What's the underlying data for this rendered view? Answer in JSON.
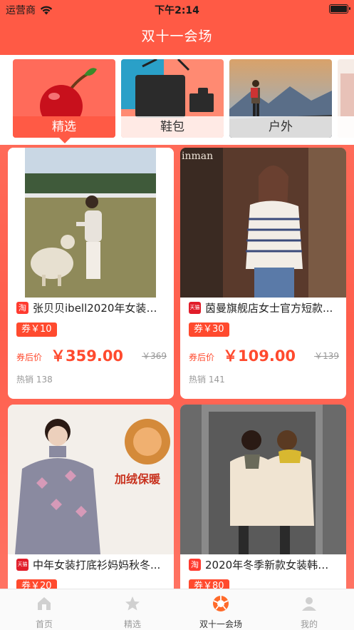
{
  "status": {
    "carrier": "运营商",
    "time": "下午2:14"
  },
  "nav": {
    "title": "双十一会场"
  },
  "categories": [
    {
      "label": "精选",
      "active": true
    },
    {
      "label": "鞋包",
      "active": false
    },
    {
      "label": "户外",
      "active": false
    }
  ],
  "products": [
    {
      "shop": "淘",
      "title": "张贝贝ibell2020年女装新...",
      "coupon": "券￥10",
      "price_label": "券后价",
      "price": "￥359.00",
      "original": "￥369",
      "sales": "热销 138"
    },
    {
      "shop": "天猫",
      "title": "茵曼旗舰店女士官方短款...",
      "coupon": "券￥30",
      "price_label": "券后价",
      "price": "￥109.00",
      "original": "￥139",
      "sales": "热销 141"
    },
    {
      "shop": "天猫",
      "title": "中年女装打底衫妈妈秋冬...",
      "coupon": "券￥20"
    },
    {
      "shop": "淘",
      "title": "2020年冬季新款女装韩版i...",
      "coupon": "券￥80"
    }
  ],
  "tabbar": [
    {
      "label": "首页",
      "icon": "home-icon"
    },
    {
      "label": "精选",
      "icon": "star-icon"
    },
    {
      "label": "双十一会场",
      "icon": "camera-shutter-icon",
      "active": true
    },
    {
      "label": "我的",
      "icon": "user-icon"
    }
  ],
  "colors": {
    "accent": "#ff5a45",
    "coupon": "#ff4a2e"
  }
}
